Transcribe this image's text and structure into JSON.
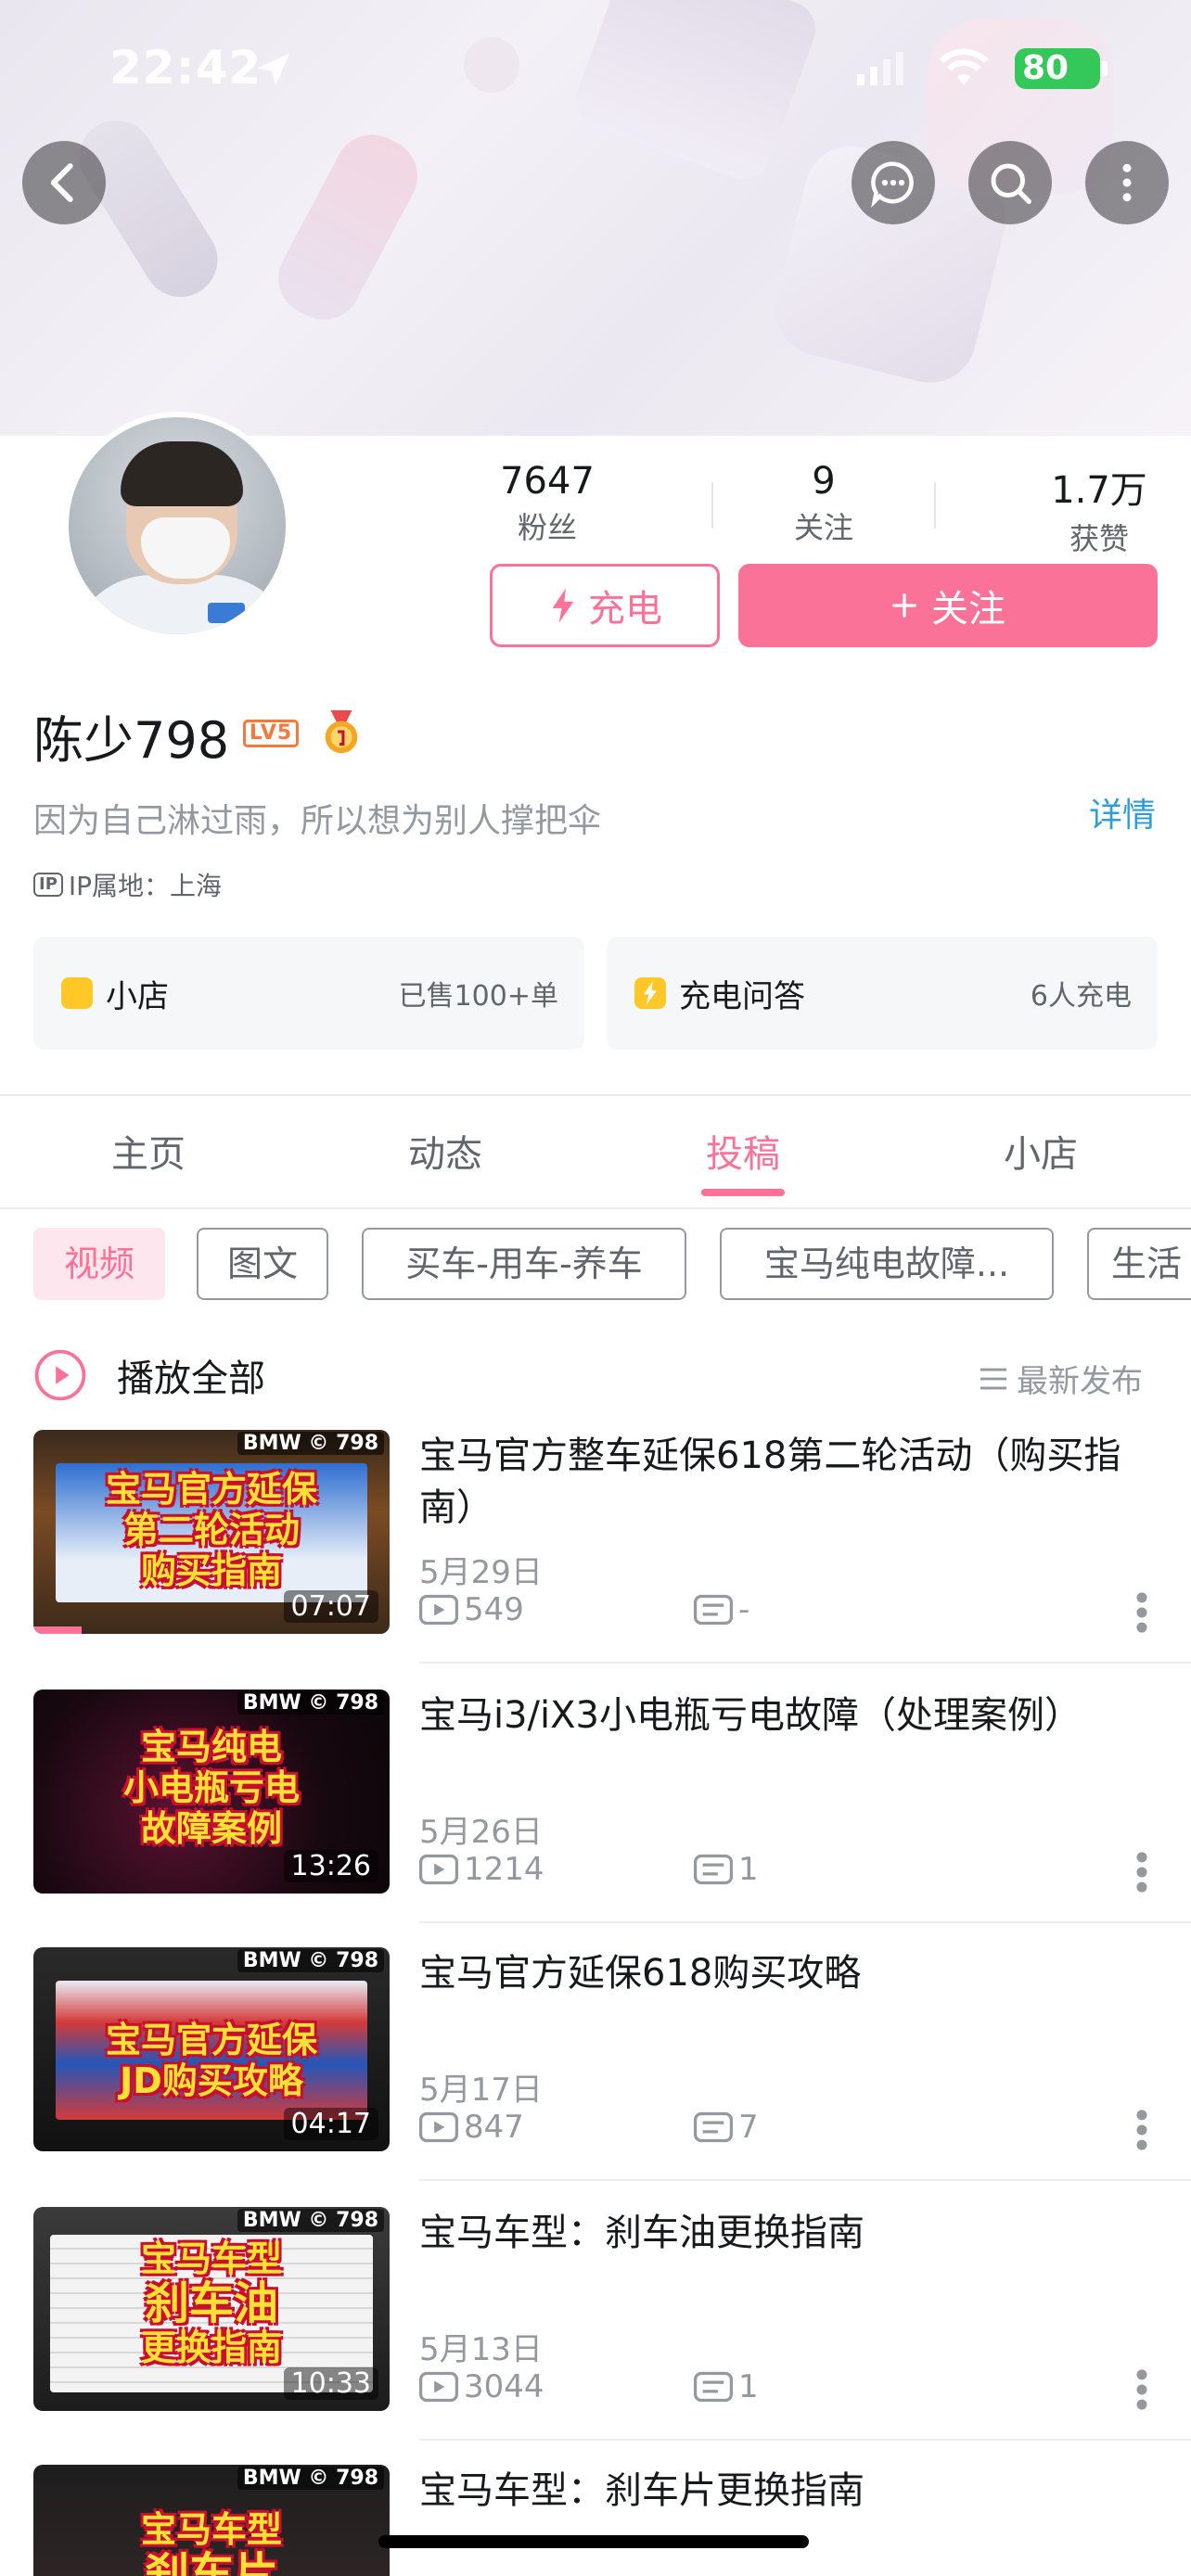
{
  "status_bar": {
    "time": "22:42",
    "battery": "80"
  },
  "profile": {
    "followers_count": "7647",
    "followers_label": "粉丝",
    "following_count": "9",
    "following_label": "关注",
    "likes_count": "1.7万",
    "likes_label": "获赞",
    "charge_label": "充电",
    "follow_label": "关注",
    "name": "陈少798",
    "level": "LV5",
    "bio": "因为自己淋过雨，所以想为别人撑把伞",
    "detail_label": "详情",
    "ip_badge": "IP",
    "ip_location": "IP属地：上海"
  },
  "cards": [
    {
      "title": "小店",
      "subtitle": "已售100+单",
      "icon_color": "#ffc727"
    },
    {
      "title": "充电问答",
      "subtitle": "6人充电",
      "icon_color": "#ffc727"
    }
  ],
  "tabs": [
    {
      "label": "主页"
    },
    {
      "label": "动态"
    },
    {
      "label": "投稿",
      "active": true
    },
    {
      "label": "小店"
    }
  ],
  "filters": [
    {
      "label": "视频",
      "active": true
    },
    {
      "label": "图文"
    },
    {
      "label": "买车-用车-养车"
    },
    {
      "label": "宝马纯电故障..."
    },
    {
      "label": "生活"
    }
  ],
  "play_all_label": "播放全部",
  "sort_label": "最新发布",
  "videos": [
    {
      "title": "宝马官方整车延保618第二轮活动（购买指南）",
      "date": "5月29日",
      "views": "549",
      "comments": "-",
      "duration": "07:07",
      "badge": "BMW © 798",
      "thumb_caption": [
        "宝马官方延保",
        "第二轮活动",
        "购买指南"
      ]
    },
    {
      "title": "宝马i3/iX3小电瓶亏电故障（处理案例）",
      "date": "5月26日",
      "views": "1214",
      "comments": "1",
      "duration": "13:26",
      "badge": "BMW © 798",
      "thumb_caption": [
        "宝马纯电",
        "小电瓶亏电",
        "故障案例"
      ]
    },
    {
      "title": "宝马官方延保618购买攻略",
      "date": "5月17日",
      "views": "847",
      "comments": "7",
      "duration": "04:17",
      "badge": "BMW © 798",
      "thumb_caption": [
        "宝马官方延保",
        "JD购买攻略"
      ]
    },
    {
      "title": "宝马车型：刹车油更换指南",
      "date": "5月13日",
      "views": "3044",
      "comments": "1",
      "duration": "10:33",
      "badge": "BMW © 798",
      "thumb_caption": [
        "宝马车型",
        "刹车油",
        "更换指南"
      ]
    },
    {
      "title": "宝马车型：刹车片更换指南",
      "badge": "BMW © 798",
      "thumb_caption": [
        "宝马车型",
        "刹车片"
      ]
    }
  ],
  "colors": {
    "accent": "#fb7299",
    "link": "#2f9ed8",
    "level": "#f17a3c"
  }
}
